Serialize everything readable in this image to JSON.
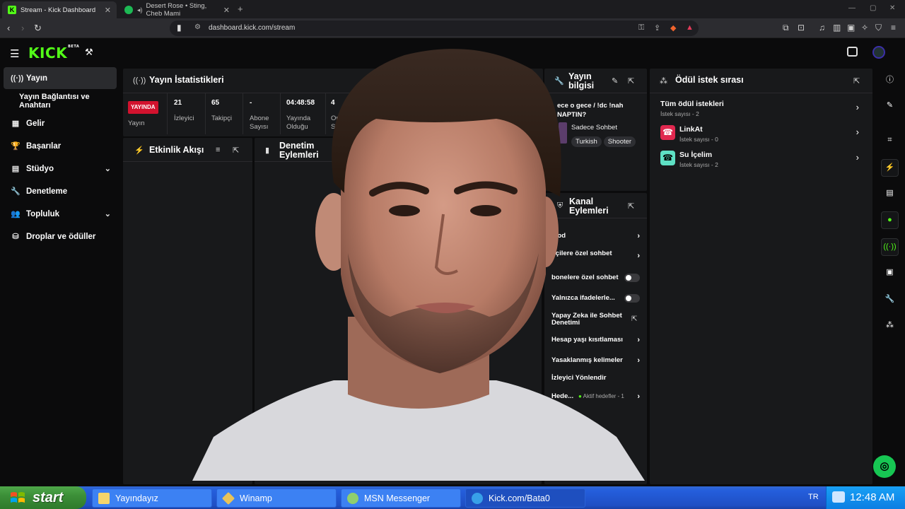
{
  "browser": {
    "tabs": [
      {
        "title": "Stream - Kick Dashboard",
        "active": true
      },
      {
        "title": "Desert Rose • Sting, Cheb Mami",
        "active": false
      }
    ],
    "url": "dashboard.kick.com/stream"
  },
  "brand": {
    "logo": "KICK",
    "logo_sup": "BETA",
    "accent": "#53fc18"
  },
  "sidebar": {
    "items": [
      {
        "label": "Yayın",
        "icon": "broadcast-icon"
      },
      {
        "label": "Yayın Bağlantısı ve Anahtarı",
        "icon": ""
      },
      {
        "label": "Gelir",
        "icon": "chart-icon"
      },
      {
        "label": "Başarılar",
        "icon": "trophy-icon"
      },
      {
        "label": "Stüdyo",
        "icon": "studio-icon"
      },
      {
        "label": "Denetleme",
        "icon": "wrench-icon"
      },
      {
        "label": "Topluluk",
        "icon": "community-icon"
      },
      {
        "label": "Droplar ve ödüller",
        "icon": "drops-icon"
      }
    ]
  },
  "stats_panel": {
    "title": "Yayın İstatistikleri",
    "live_badge": "YAYINDA",
    "stats": [
      {
        "value": "",
        "label": "Yayın"
      },
      {
        "value": "21",
        "label": "İzleyici"
      },
      {
        "value": "65",
        "label": "Takipçi"
      },
      {
        "value": "-",
        "label": "Abone Sayısı"
      },
      {
        "value": "04:48:58",
        "label": "Yayında Olduğu"
      },
      {
        "value": "4",
        "label": "Ort Sı"
      }
    ]
  },
  "activity_panel": {
    "title": "Etkinlik Akışı"
  },
  "moderation_panel": {
    "title": "Denetim Eylemleri"
  },
  "stream_info": {
    "title": "Yayın bilgisi",
    "stream_title": "ece o gece / !dc !nah NAPTIN?",
    "category": "Sadece Sohbet",
    "tags": [
      "Turkish",
      "Shooter"
    ]
  },
  "channel_actions": {
    "title": "Kanal Eylemleri",
    "rows": [
      {
        "label": "mod",
        "control": "chevron"
      },
      {
        "label": "pçilere özel sohbet",
        "control": "chevron"
      },
      {
        "label": "bonelere özel sohbet",
        "control": "toggle"
      },
      {
        "label": "Yalnızca ifadelerle...",
        "control": "toggle"
      },
      {
        "label": "Yapay Zeka ile Sohbet Denetimi",
        "control": "external"
      },
      {
        "label": "Hesap yaşı kısıtlaması",
        "control": "chevron"
      },
      {
        "label": "Yasaklanmış kelimeler",
        "control": "chevron"
      },
      {
        "label": "İzleyici Yönlendir",
        "control": "none"
      },
      {
        "label": "Hede...",
        "extra": "Aktif hedefler - 1",
        "control": "chevron"
      }
    ]
  },
  "rewards_panel": {
    "title": "Ödül istek sırası",
    "items": [
      {
        "title": "Tüm ödül istekleri",
        "sub": "İstek sayısı - 2"
      },
      {
        "title": "LinkAt",
        "sub": "İstek sayısı - 0",
        "color": "#e0284f"
      },
      {
        "title": "Su İçelim",
        "sub": "İstek sayısı - 2",
        "color": "#5ee0c4"
      }
    ]
  },
  "taskbar": {
    "start_label": "start",
    "tasks": [
      "Yayındayız",
      "Winamp",
      "MSN Messenger",
      "Kick.com/Bata0"
    ],
    "language": "TR",
    "clock": "12:48 AM"
  }
}
